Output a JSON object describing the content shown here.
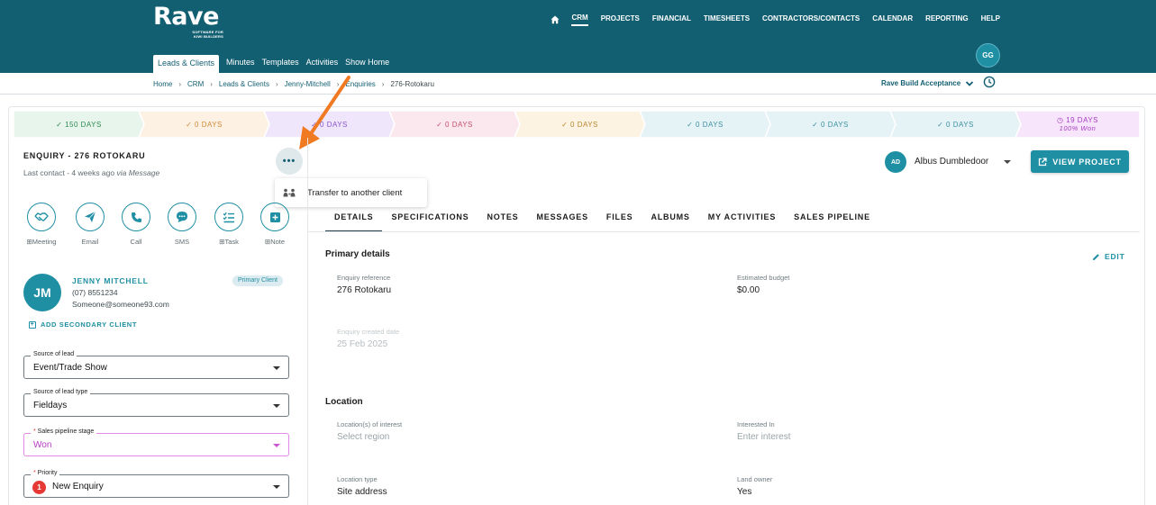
{
  "brand": {
    "name": "Rave",
    "tagline_1": "SOFTWARE FOR",
    "tagline_2": "KIWI BUILDERS"
  },
  "top_nav": [
    "CRM",
    "PROJECTS",
    "FINANCIAL",
    "TIMESHEETS",
    "CONTRACTORS/CONTACTS",
    "CALENDAR",
    "REPORTING",
    "HELP"
  ],
  "user_initials": "GG",
  "sub_nav": [
    "Leads & Clients",
    "Minutes",
    "Templates",
    "Activities",
    "Show Home"
  ],
  "breadcrumb": [
    "Home",
    "CRM",
    "Leads & Clients",
    "Jenny-Mitchell",
    "Enquiries",
    "276-Rotokaru"
  ],
  "acceptance_label": "Rave Build Acceptance",
  "pipeline": [
    {
      "label": "✓ 150 DAYS",
      "color": "#2e8a50",
      "bg": "#e8f5ec"
    },
    {
      "label": "✓ 0 DAYS",
      "color": "#d08a35",
      "bg": "#fdf1e4"
    },
    {
      "label": "✓ 0 DAYS",
      "color": "#8a55c8",
      "bg": "#efe6fb"
    },
    {
      "label": "✓ 0 DAYS",
      "color": "#c2506e",
      "bg": "#fbe8ee"
    },
    {
      "label": "✓ 0 DAYS",
      "color": "#b7862c",
      "bg": "#fcf3e3"
    },
    {
      "label": "✓ 0 DAYS",
      "color": "#3c8fa0",
      "bg": "#e6f3f6"
    },
    {
      "label": "✓ 0 DAYS",
      "color": "#3c8fa0",
      "bg": "#e6f3f6"
    },
    {
      "label": "✓ 0 DAYS",
      "color": "#3c8fa0",
      "bg": "#e6f3f6"
    },
    {
      "label": "◷ 19 DAYS",
      "sub": "100% Won",
      "color": "#a63cc4",
      "bg": "#f7e6fb"
    }
  ],
  "enquiry": {
    "title": "ENQUIRY - 276 ROTOKARU",
    "last_contact": "Last contact - 4 weeks ago ",
    "last_contact_via": "via Message",
    "more_label": "•••",
    "menu_item": "Transfer to another client"
  },
  "actions": [
    {
      "label": "Meeting",
      "prefix": "⊞",
      "icon": "handshake-icon"
    },
    {
      "label": "Email",
      "prefix": "",
      "icon": "send-icon"
    },
    {
      "label": "Call",
      "prefix": "",
      "icon": "phone-icon"
    },
    {
      "label": "SMS",
      "prefix": "",
      "icon": "chat-icon"
    },
    {
      "label": "Task",
      "prefix": "⊞",
      "icon": "checklist-icon"
    },
    {
      "label": "Note",
      "prefix": "⊞",
      "icon": "note-icon"
    }
  ],
  "client": {
    "initials": "JM",
    "name": "JENNY MITCHELL",
    "phone": "(07) 8551234",
    "email": "Someone@someone93.com",
    "badge": "Primary Client",
    "add_secondary": "ADD SECONDARY CLIENT"
  },
  "fields": {
    "source_of_lead": {
      "label": "Source of lead",
      "value": "Event/Trade Show"
    },
    "source_of_lead_type": {
      "label": "Source of lead type",
      "value": "Fieldays"
    },
    "sales_pipeline_stage": {
      "label": "Sales pipeline stage",
      "value": "Won"
    },
    "priority": {
      "label": "Priority",
      "value": "New Enquiry",
      "badge": "1"
    }
  },
  "owner": {
    "initials": "AD",
    "name": "Albus Dumbledoor"
  },
  "view_project_label": "VIEW PROJECT",
  "tabs": [
    "DETAILS",
    "SPECIFICATIONS",
    "NOTES",
    "MESSAGES",
    "FILES",
    "ALBUMS",
    "MY ACTIVITIES",
    "SALES PIPELINE"
  ],
  "primary_details": {
    "heading": "Primary details",
    "edit_label": "EDIT",
    "enquiry_reference": {
      "label": "Enquiry reference",
      "value": "276 Rotokaru"
    },
    "estimated_budget": {
      "label": "Estimated budget",
      "value": "$0.00"
    },
    "created_date": {
      "label": "Enquiry created date",
      "value": "25 Feb 2025"
    }
  },
  "location": {
    "heading": "Location",
    "locations_of_interest": {
      "label": "Location(s) of interest",
      "value": "Select region"
    },
    "interested_in": {
      "label": "Interested In",
      "value": "Enter interest"
    },
    "location_type": {
      "label": "Location type",
      "value": "Site address"
    },
    "land_owner": {
      "label": "Land owner",
      "value": "Yes"
    }
  },
  "colors": {
    "header": "#135f72",
    "accent": "#1f8fa4",
    "arrow": "#f07a22"
  }
}
